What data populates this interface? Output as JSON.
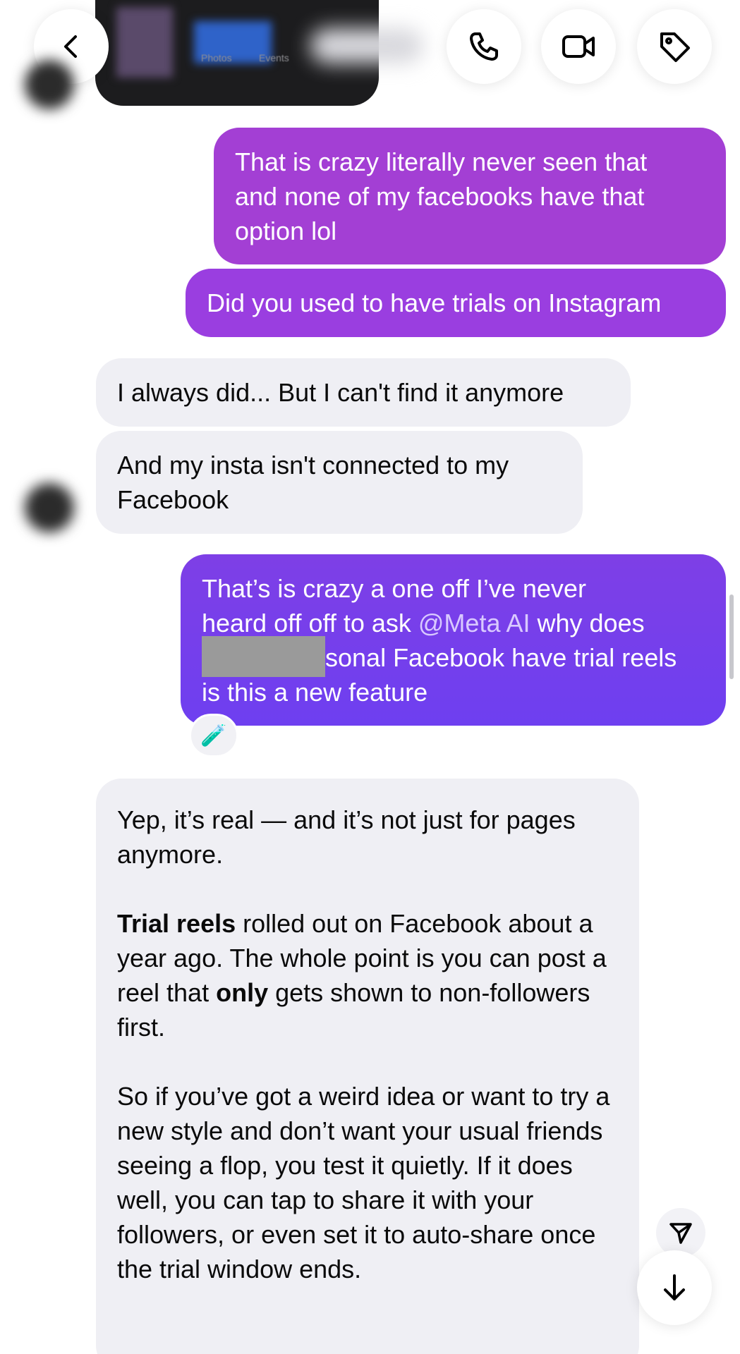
{
  "header": {
    "back_icon": "chevron-left-icon",
    "call_icon": "phone-icon",
    "video_icon": "video-camera-icon",
    "tag_icon": "tag-icon",
    "shared_preview_tabs": [
      "Photos",
      "Events"
    ]
  },
  "messages": [
    {
      "from": "me",
      "lines": [
        "That is crazy  literally never seen that",
        "and none of my facebooks have that",
        "option lol"
      ]
    },
    {
      "from": "me",
      "lines": [
        "Did you used to have trials on Instagram"
      ]
    },
    {
      "from": "them",
      "lines": [
        "I always did... But I can't find it anymore"
      ]
    },
    {
      "from": "them",
      "lines": [
        "And my insta isn't connected to my",
        "Facebook"
      ]
    },
    {
      "from": "me",
      "line1": "That’s is crazy a one off I’ve never",
      "line2_pre": "heard off off to ask ",
      "mention": "@Meta AI",
      "line2_post": " why does",
      "line3_post": "sonal Facebook have trial reels",
      "line4": "is this a new feature",
      "reaction": "🧪"
    }
  ],
  "ai_reply": {
    "p1": "Yep, it’s real — and it’s not just for pages anymore.",
    "p2_bold": "Trial reels",
    "p2_a": " rolled out on Facebook about a year ago. The whole point is you can post a reel that ",
    "p2_bold2": "only",
    "p2_b": " gets shown to non-followers first.",
    "p3": "So if you’ve got a weird idea or want to try a new style and don’t want your usual friends seeing a flop, you test it quietly. If it does well, you can tap to share it with your followers, or even set it to auto-share once the trial window ends."
  },
  "controls": {
    "share_icon": "paper-plane-icon",
    "scroll_down_icon": "arrow-down-icon"
  },
  "colors": {
    "outgoing_top": "#a33fd4",
    "outgoing_mid": "#9a3ee0",
    "outgoing_bottom": "#6e3ff0",
    "incoming": "#efeff4"
  }
}
